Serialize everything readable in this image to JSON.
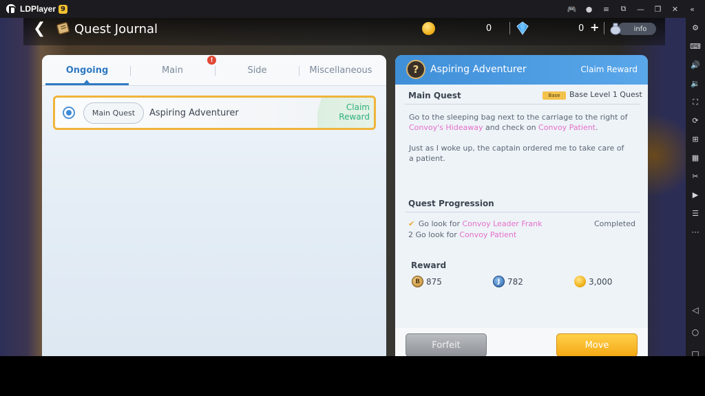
{
  "emulator": {
    "app_name": "LDPlayer",
    "version_badge": "9"
  },
  "header": {
    "title": "Quest Journal",
    "coin_value": "0",
    "gem_value": "0",
    "info_label": "info"
  },
  "tabs": [
    {
      "label": "Ongoing",
      "active": true
    },
    {
      "label": "Main",
      "active": false
    },
    {
      "label": "Side",
      "active": false
    },
    {
      "label": "Miscellaneous",
      "active": false
    }
  ],
  "tab_alert": "!",
  "quest_list": [
    {
      "type": "Main Quest",
      "name": "Aspiring Adventurer",
      "status_line1": "Claim",
      "status_line2": "Reward",
      "selected": true
    }
  ],
  "detail": {
    "title": "Aspiring Adventurer",
    "claim_label": "Claim Reward",
    "section_main": "Main Quest",
    "base_badge": "Base",
    "base_level": "Base Level 1 Quest",
    "desc1_a": "Go to the sleeping bag next to the carriage to the right of",
    "desc1_link1": "Convoy's Hideaway",
    "desc1_b": " and check on ",
    "desc1_link2": "Convoy Patient",
    "desc1_c": ".",
    "desc2": "Just as I woke up, the captain ordered me to take care of a patient.",
    "progression_title": "Quest Progression",
    "progression": [
      {
        "marker": "✔",
        "prefix": "Go look for ",
        "target": "Convoy Leader Frank",
        "status": "Completed"
      },
      {
        "marker": "2",
        "prefix": "Go look for ",
        "target": "Convoy Patient",
        "status": ""
      }
    ],
    "reward_title": "Reward",
    "rewards": [
      {
        "icon": "bronze-b-coin-icon",
        "glyph": "B",
        "value": "875"
      },
      {
        "icon": "blue-j-token-icon",
        "glyph": "J",
        "value": "782"
      },
      {
        "icon": "gold-coin-icon",
        "glyph": "",
        "value": "3,000"
      }
    ],
    "forfeit_label": "Forfeit",
    "move_label": "Move"
  },
  "colors": {
    "accent_blue": "#2f79c2",
    "highlight_orange": "#f0b43a",
    "claim_green": "#2fb07c",
    "link_pink": "#e46fc9",
    "move_yellow": "#f4a916"
  }
}
